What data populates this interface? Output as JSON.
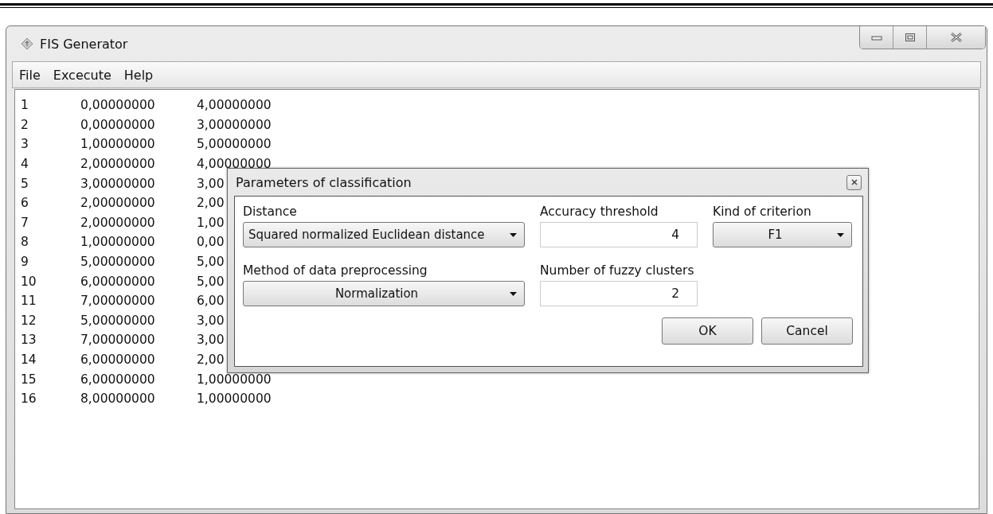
{
  "window": {
    "title": "FIS Generator"
  },
  "menu": [
    "File",
    "Excecute",
    "Help"
  ],
  "rows": [
    {
      "cells": [
        "1",
        "0,00000000",
        "4,00000000"
      ]
    },
    {
      "cells": [
        "2",
        "0,00000000",
        "3,00000000"
      ]
    },
    {
      "cells": [
        "3",
        "1,00000000",
        "5,00000000"
      ]
    },
    {
      "cells": [
        "4",
        "2,00000000",
        "4,00000000"
      ]
    },
    {
      "cells": [
        "5",
        "3,00000000",
        "3,00"
      ]
    },
    {
      "cells": [
        "6",
        "2,00000000",
        "2,00"
      ]
    },
    {
      "cells": [
        "7",
        "2,00000000",
        "1,00"
      ]
    },
    {
      "cells": [
        "8",
        "1,00000000",
        "0,00"
      ]
    },
    {
      "cells": [
        "9",
        "5,00000000",
        "5,00"
      ]
    },
    {
      "cells": [
        "10",
        "6,00000000",
        "5,00"
      ]
    },
    {
      "cells": [
        "11",
        "7,00000000",
        "6,00"
      ]
    },
    {
      "cells": [
        "12",
        "5,00000000",
        "3,00"
      ]
    },
    {
      "cells": [
        "13",
        "7,00000000",
        "3,00"
      ]
    },
    {
      "cells": [
        "14",
        "6,00000000",
        "2,00"
      ]
    },
    {
      "cells": [
        "15",
        "6,00000000",
        "1,00000000"
      ]
    },
    {
      "cells": [
        "16",
        "8,00000000",
        "1,00000000"
      ]
    }
  ],
  "dialog": {
    "title": "Parameters of classification",
    "fields": [
      {
        "kind": "dropdown",
        "label": "Distance",
        "value": "Squared normalized Euclidean distance",
        "centered": false
      },
      {
        "kind": "input",
        "label": "Accuracy threshold",
        "value": "4"
      },
      {
        "kind": "dropdown",
        "label": "Kind of criterion",
        "value": "F1",
        "centered": true
      },
      {
        "kind": "dropdown",
        "label": "Method of data preprocessing",
        "value": "Normalization",
        "centered": true
      },
      {
        "kind": "input",
        "label": "Number of fuzzy clusters",
        "value": "2"
      }
    ],
    "buttons": [
      "OK",
      "Cancel"
    ]
  }
}
